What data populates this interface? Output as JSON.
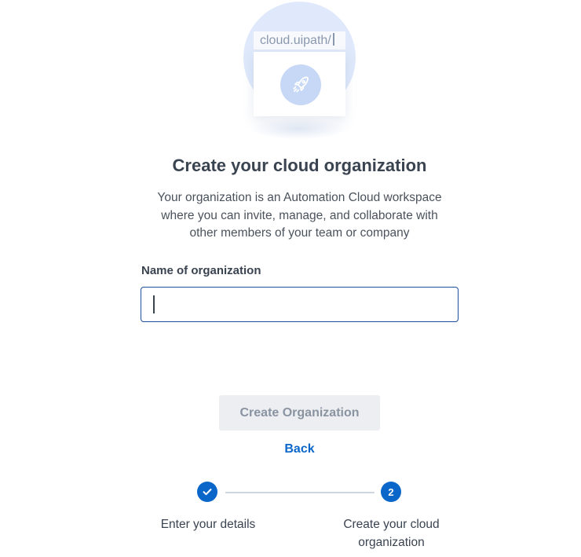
{
  "illustration": {
    "url_text": "cloud.uipath/",
    "icon": "rocket-icon"
  },
  "page": {
    "title": "Create your cloud organization",
    "description_lines": [
      "Your organization is an Automation Cloud workspace",
      "where you can invite, manage, and collaborate with",
      "other members of your team or company"
    ]
  },
  "form": {
    "org_name_label": "Name of organization",
    "org_name_value": ""
  },
  "actions": {
    "create_label": "Create Organization",
    "back_label": "Back"
  },
  "stepper": {
    "steps": [
      {
        "label_lines": [
          "Enter your details"
        ],
        "state": "completed",
        "icon": "check-icon"
      },
      {
        "label_lines": [
          "Create your cloud",
          "organization"
        ],
        "state": "current",
        "number": "2"
      }
    ]
  },
  "colors": {
    "accent": "#0a67c9",
    "input_border": "#1c4f9c",
    "illustration_bg": "#dfe9fb",
    "disabled_button_bg": "#eceef1"
  }
}
